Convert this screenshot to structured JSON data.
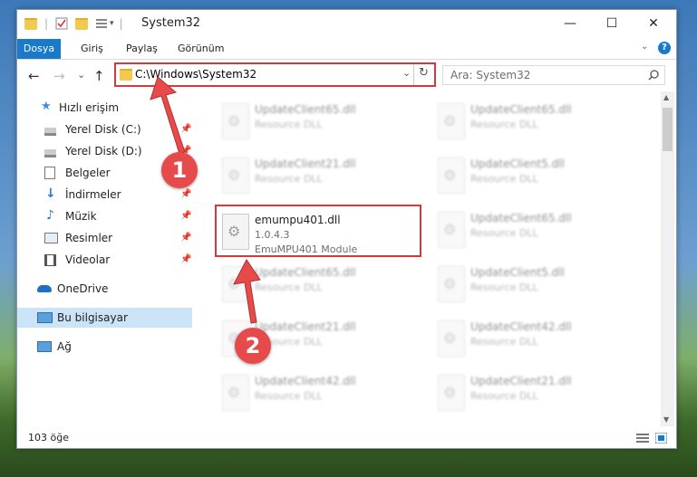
{
  "window": {
    "title": "System32",
    "buttons": {
      "minimize": "—",
      "maximize": "☐",
      "close": "✕"
    }
  },
  "ribbon": {
    "tabs": [
      {
        "label": "Dosya",
        "active": true
      },
      {
        "label": "Giriş",
        "active": false
      },
      {
        "label": "Paylaş",
        "active": false
      },
      {
        "label": "Görünüm",
        "active": false
      }
    ],
    "help": "?"
  },
  "nav": {
    "back": "←",
    "forward": "→",
    "recent": "⌄",
    "up": "↑",
    "address": "C:\\Windows\\System32",
    "refresh": "↻",
    "search_placeholder": "Ara: System32"
  },
  "sidebar": {
    "quick_access": "Hızlı erişim",
    "items": [
      {
        "label": "Yerel Disk (C:)",
        "pinned": true
      },
      {
        "label": "Yerel Disk (D:)",
        "pinned": true
      },
      {
        "label": "Belgeler",
        "pinned": true
      },
      {
        "label": "İndirmeler",
        "pinned": true
      },
      {
        "label": "Müzik",
        "pinned": true
      },
      {
        "label": "Resimler",
        "pinned": true
      },
      {
        "label": "Videolar",
        "pinned": true
      }
    ],
    "onedrive": "OneDrive",
    "thispc": "Bu bilgisayar",
    "network": "Ağ"
  },
  "files": {
    "left": [
      {
        "name": "UpdateClient65.dll",
        "desc": "Resource DLL"
      },
      {
        "name": "UpdateClient21.dll",
        "desc": "Resource DLL"
      },
      {
        "name": "emumpu401.dll",
        "version": "1.0.4.3",
        "desc": "EmuMPU401 Module"
      },
      {
        "name": "UpdateClient65.dll",
        "desc": "Resource DLL"
      },
      {
        "name": "UpdateClient21.dll",
        "desc": "Resource DLL"
      },
      {
        "name": "UpdateClient42.dll",
        "desc": "Resource DLL"
      }
    ],
    "right": [
      {
        "name": "UpdateClient65.dll",
        "desc": "Resource DLL"
      },
      {
        "name": "UpdateClient5.dll",
        "desc": "Resource DLL"
      },
      {
        "name": "UpdateClient65.dll",
        "desc": "Resource DLL"
      },
      {
        "name": "UpdateClient5.dll",
        "desc": "Resource DLL"
      },
      {
        "name": "UpdateClient42.dll",
        "desc": "Resource DLL"
      },
      {
        "name": "UpdateClient21.dll",
        "desc": "Resource DLL"
      }
    ]
  },
  "status": {
    "count": "103 öğe"
  },
  "callouts": {
    "one": "1",
    "two": "2"
  },
  "colors": {
    "accent": "#1979ca",
    "highlight": "#d9363e",
    "callout": "#e64a4a"
  }
}
